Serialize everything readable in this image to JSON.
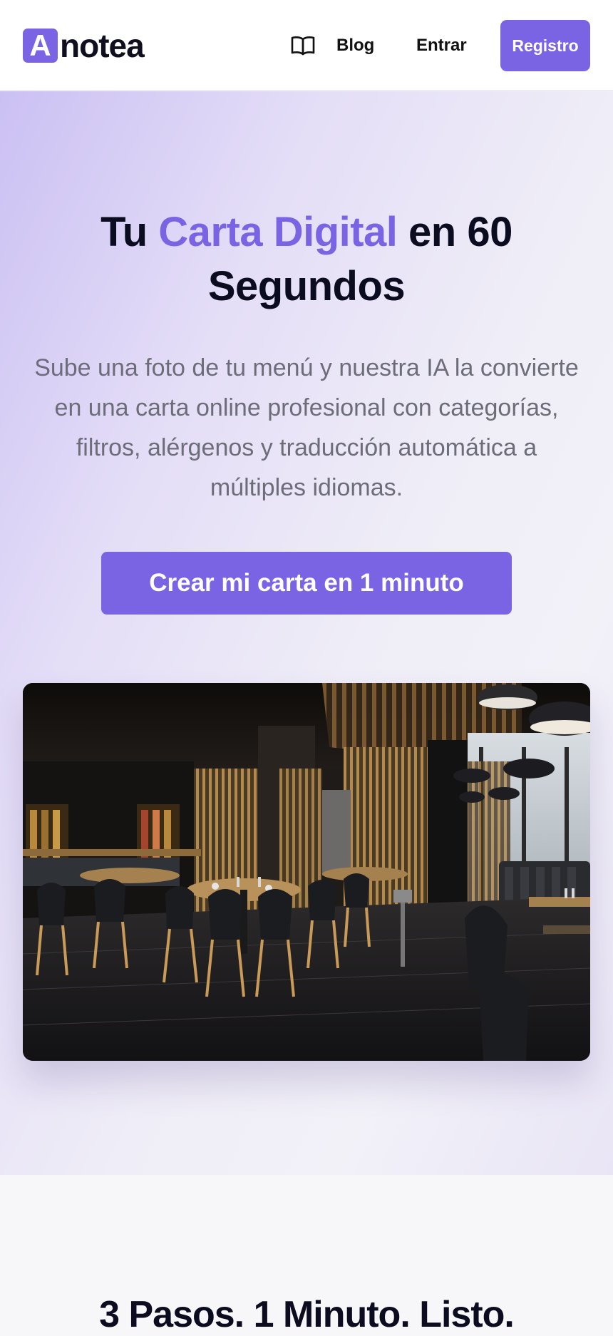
{
  "brand": {
    "logo_letter": "A",
    "logo_text": "notea",
    "accent_color": "#7b64e4"
  },
  "nav": {
    "blog_icon": "book-open-icon",
    "blog_label": "Blog",
    "login_label": "Entrar",
    "register_label": "Registro"
  },
  "hero": {
    "title_prefix": "Tu ",
    "title_accent": "Carta Digital",
    "title_suffix": " en 60 Segundos",
    "subtitle": "Sube una foto de tu menú y nuestra IA la convierte en una carta online profesional con categorías, filtros, alérgenos y traducción automática a múltiples idiomas.",
    "cta_label": "Crear mi carta en 1 minuto",
    "image_subject": "restaurant-interior-photo"
  },
  "steps": {
    "title": "3 Pasos. 1 Minuto. Listo."
  }
}
